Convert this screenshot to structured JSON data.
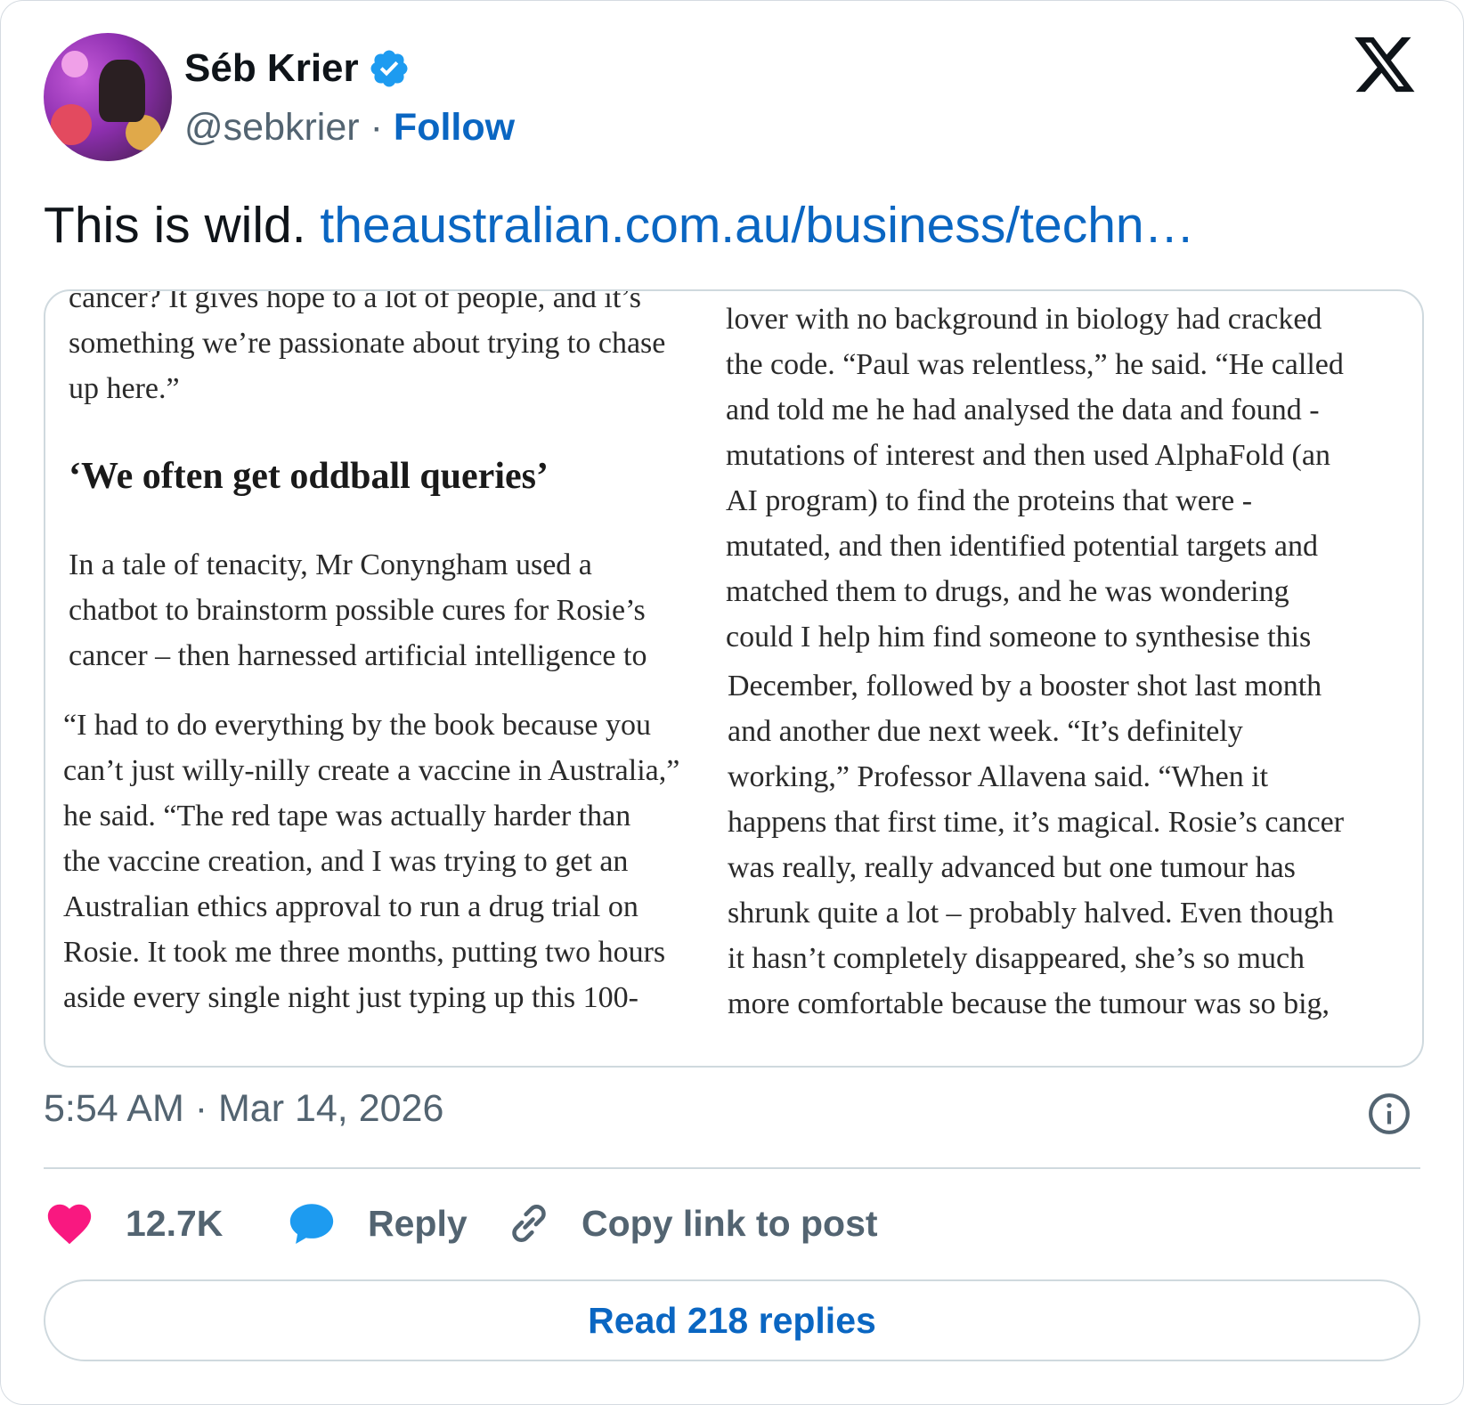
{
  "author": {
    "name": "Séb Krier",
    "handle": "@sebkrier",
    "separator": "·",
    "follow_label": "Follow"
  },
  "tweet": {
    "text": "This is wild.",
    "link_text": "theaustralian.com.au/business/techn…"
  },
  "article_image": {
    "left_top": {
      "lines": [
        "cancer? It gives hope to a lot of people, and it’s",
        "something we’re passionate about trying to chase",
        "up here.”"
      ],
      "heading": "‘We often get oddball queries’",
      "lines2": [
        "In a tale of tenacity, Mr Conyngham used a",
        "chatbot to brainstorm possible cures for Rosie’s",
        "cancer – then harnessed artificial intelligence to"
      ]
    },
    "right_top": {
      "lines": [
        "lover with no background in biology had cracked",
        "the code. “Paul was relentless,” he said. “He called",
        "and told me he had analysed the data and found -",
        "mutations of interest and then used AlphaFold (an",
        "AI program) to find the proteins that were -",
        "mutated, and then identified potential targets and",
        "matched them to drugs, and he was wondering",
        "could I help him find someone to synthesise this"
      ]
    },
    "left_bottom": {
      "lines": [
        "“I had to do everything by the book because you",
        "can’t just willy-nilly create a vaccine in Australia,”",
        "he said. “The red tape was actually harder than",
        "the vaccine creation, and I was trying to get an",
        "Australian ethics approval to run a drug trial on",
        "Rosie. It took me three months, putting two hours",
        "aside every single night just typing up this 100-"
      ]
    },
    "right_bottom": {
      "lines": [
        "December, followed by a booster shot last month",
        "and another due next week. “It’s definitely",
        "working,” Professor Allavena said. “When it",
        "happens that first time, it’s magical. Rosie’s cancer",
        "was really, really advanced but one tumour has",
        "shrunk quite a lot – probably halved. Even though",
        "it hasn’t completely disappeared, she’s so much",
        "more comfortable because the tumour was so big,"
      ]
    }
  },
  "meta": {
    "timestamp": "5:54 AM · Mar 14, 2026"
  },
  "actions": {
    "like_count": "12.7K",
    "reply_label": "Reply",
    "copy_label": "Copy link to post"
  },
  "read_replies_label": "Read 218 replies",
  "colors": {
    "link": "#0a66c2",
    "verified": "#1d9bf0",
    "heart": "#f91880",
    "muted": "#536471",
    "border": "#cfd9de"
  },
  "icons": {
    "verified": "verified-badge-icon",
    "brand": "x-logo-icon",
    "info": "info-icon",
    "like": "heart-icon",
    "reply": "speech-bubble-icon",
    "copy": "link-icon"
  }
}
